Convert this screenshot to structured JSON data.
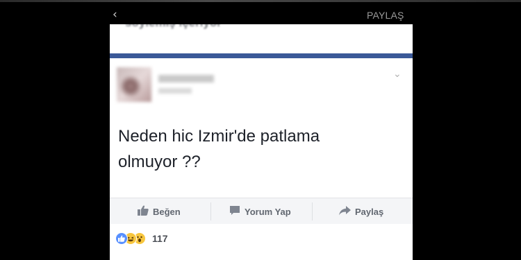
{
  "top_bar": {
    "back_glyph": "‹",
    "share_label": "PAYLAŞ"
  },
  "previous_post": {
    "header_text": "söylemiş içeriyor"
  },
  "post": {
    "text_line1": "Neden hic Izmir'de patlama",
    "text_line2": "olmuyor ??",
    "options_glyph": "⌄"
  },
  "actions": {
    "like_label": "Beğen",
    "comment_label": "Yorum Yap",
    "share_label": "Paylaş"
  },
  "reactions": {
    "count": "117",
    "types": [
      "like",
      "haha",
      "wow"
    ]
  },
  "colors": {
    "facebook_blue": "#3b5998",
    "like_blue": "#5890ff",
    "emoji_yellow": "#f7c63e",
    "action_gray": "#616770"
  }
}
